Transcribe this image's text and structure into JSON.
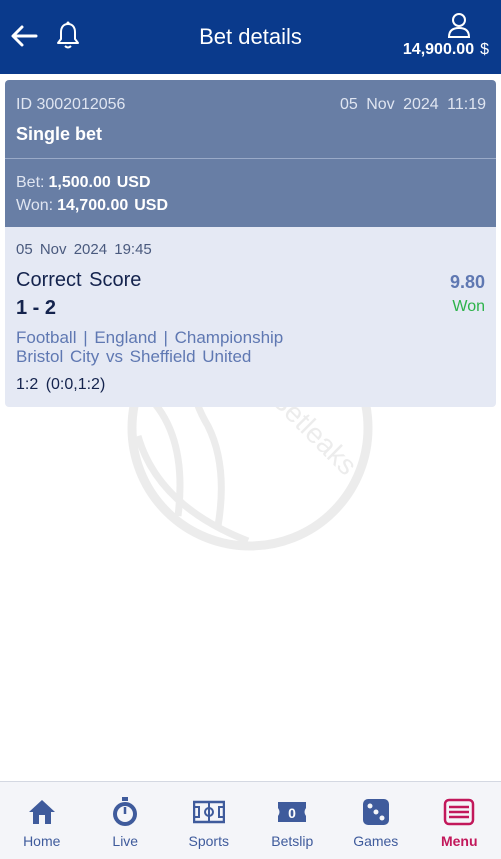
{
  "header": {
    "title": "Bet details",
    "balance_amount": "14,900.00",
    "balance_currency": "$",
    "back_icon": "back-arrow-icon",
    "notification_icon": "bell-icon",
    "account_icon": "user-icon"
  },
  "bet": {
    "id": "ID 3002012056",
    "date": "05 Nov 2024 11:19",
    "type": "Single bet",
    "bet_label": "Bet:",
    "bet_amount": "1,500.00",
    "bet_currency": "USD",
    "won_label": "Won:",
    "won_amount": "14,700.00",
    "won_currency": "USD"
  },
  "event": {
    "date": "05 Nov 2024 19:45",
    "market": "Correct Score",
    "selection": "1 - 2",
    "odds": "9.80",
    "status": "Won",
    "path": "Football | England | Championship",
    "match": "Bristol City vs Sheffield United",
    "result": "1:2 (0:0,1:2)"
  },
  "watermark": {
    "text": "Betleaks"
  },
  "nav": {
    "items": [
      {
        "label": "Home",
        "icon": "home-icon"
      },
      {
        "label": "Live",
        "icon": "stopwatch-icon"
      },
      {
        "label": "Sports",
        "icon": "pitch-icon"
      },
      {
        "label": "Betslip",
        "icon": "betslip-icon",
        "count": "0"
      },
      {
        "label": "Games",
        "icon": "dice-icon"
      },
      {
        "label": "Menu",
        "icon": "menu-icon"
      }
    ],
    "active": "Menu"
  },
  "colors": {
    "header_bg": "#0a3a8c",
    "card_top_bg": "#687ea5",
    "card_bottom_bg": "#e5e9f4",
    "odds": "#5f78b2",
    "won": "#2db34a",
    "nav_active": "#c2185b",
    "nav_default": "#3f5b9c"
  }
}
